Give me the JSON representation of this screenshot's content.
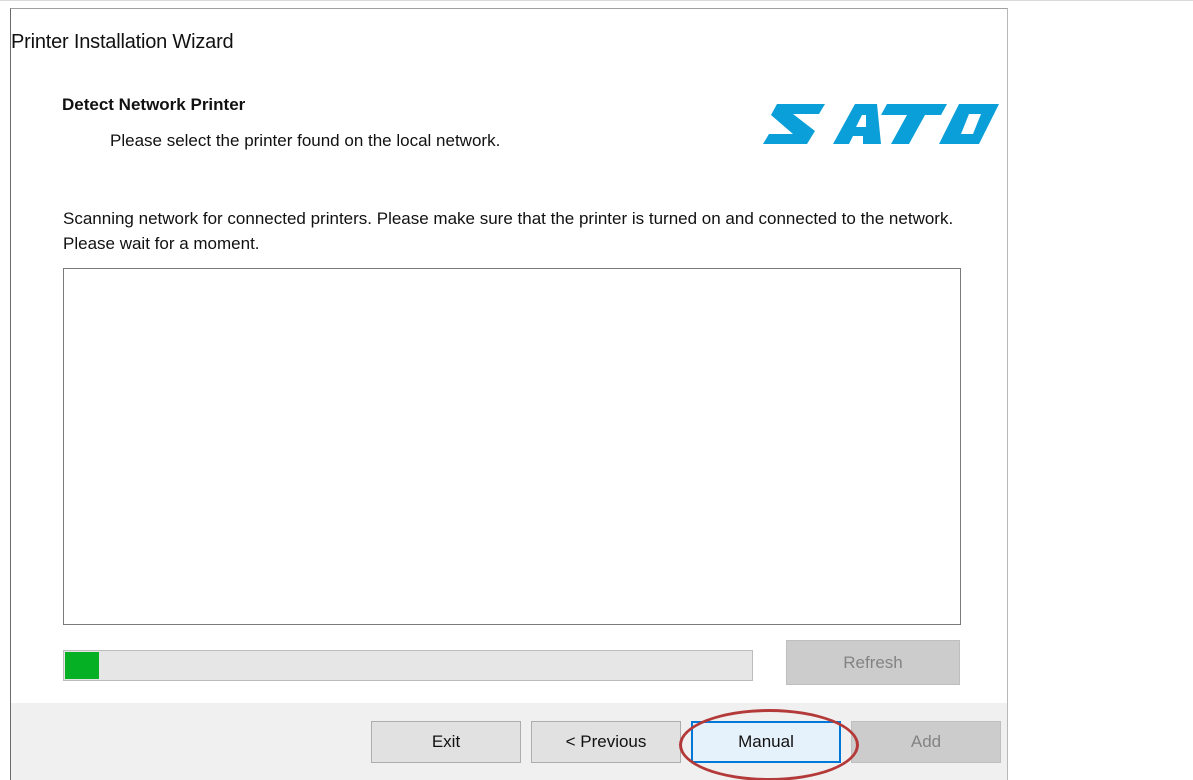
{
  "window": {
    "title": "Printer Installation Wizard"
  },
  "header": {
    "heading": "Detect Network Printer",
    "subheading": "Please select the printer found on the local network.",
    "logo_text": "SATO",
    "logo_color": "#0a9fd8"
  },
  "main": {
    "scan_message": "Scanning network for connected printers. Please make sure that the printer is turned on and connected to the network. Please wait for a moment.",
    "printer_list": [],
    "progress_fraction": 0.05,
    "progress_color": "#06b025",
    "refresh_label": "Refresh",
    "refresh_enabled": false
  },
  "footer": {
    "exit_label": "Exit",
    "previous_label": "< Previous",
    "manual_label": "Manual",
    "add_label": "Add",
    "add_enabled": false
  },
  "annotation": {
    "highlighted_button": "Manual",
    "color": "#b43a3a"
  }
}
